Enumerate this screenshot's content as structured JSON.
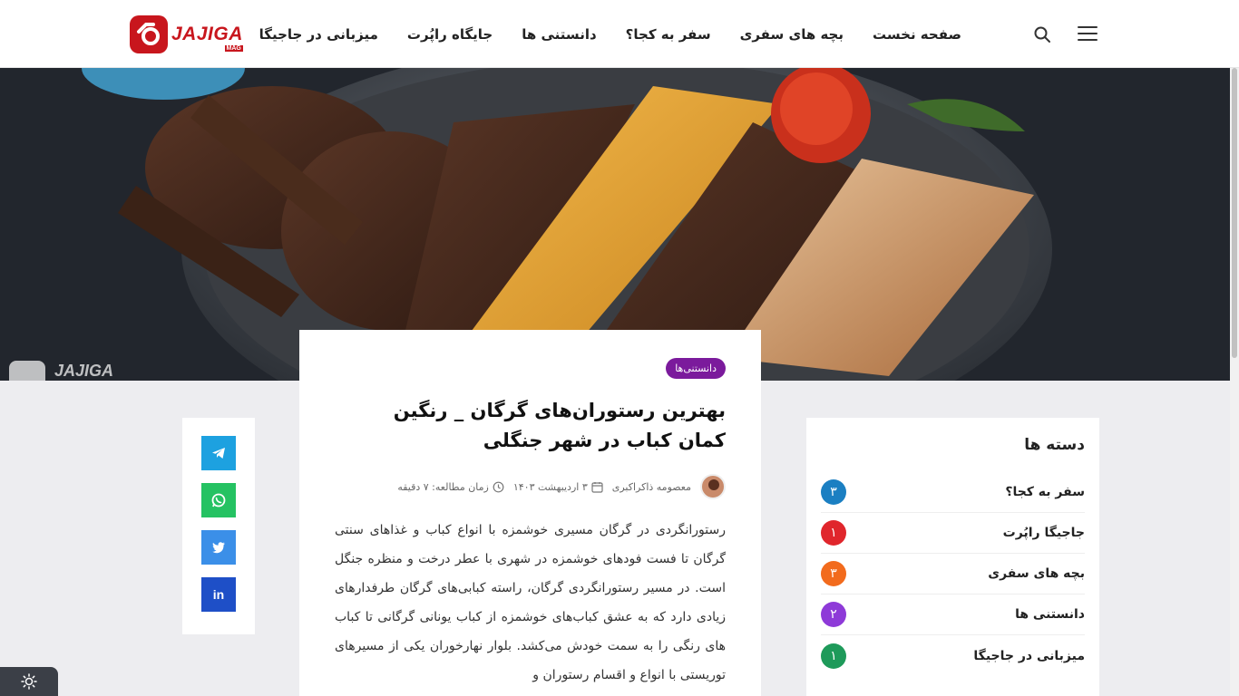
{
  "header": {
    "logo_text": "JAJIGA",
    "logo_sub": "MAG",
    "nav": [
      {
        "label": "صفحه نخست"
      },
      {
        "label": "بچه های سفری"
      },
      {
        "label": "سفر به کجا؟"
      },
      {
        "label": "دانستنی ها"
      },
      {
        "label": "جایگاه راپُرت"
      },
      {
        "label": "میزبانی در جاجیگا"
      }
    ]
  },
  "hero": {
    "watermark": "JAJIGA"
  },
  "article": {
    "category": "دانستنی‌ها",
    "title": "بهترین رستوران‌های گرگان _ رنگین کمان کباب در شهر جنگلی",
    "author": "معصومه ذاکراکبری",
    "date": "۳ اردیبهشت ۱۴۰۳",
    "reading_time": "زمان مطالعه: ۷ دقیقه",
    "body": "رستورانگردی در گرگان مسیری خوشمزه با انواع کباب و غذاهای سنتی گرگان تا فست فودهای خوشمزه در شهری با عطر درخت و منظره جنگل است. در مسیر رستورانگردی گرگان، راسته کبابی‌های گرگان طرفدارهای زیادی دارد که به عشق کباب‌های خوشمزه از کباب یونانی گرگانی تا کباب های رنگی را به سمت خودش می‌کشد. بلوار نهارخوران یکی از مسیرهای توریستی با انواع و اقسام رستوران و"
  },
  "share": {
    "buttons": [
      {
        "name": "telegram",
        "color": "#1da1e0"
      },
      {
        "name": "whatsapp",
        "color": "#25c262"
      },
      {
        "name": "twitter",
        "color": "#3b8fe8"
      },
      {
        "name": "linkedin",
        "color": "#1e4fc7",
        "label": "in"
      }
    ]
  },
  "categories": {
    "title": "دسته ها",
    "items": [
      {
        "name": "سفر به کجا؟",
        "count": "۳",
        "color": "#1b7fc2"
      },
      {
        "name": "جاجیگا راپُرت",
        "count": "۱",
        "color": "#e0262c"
      },
      {
        "name": "بچه های سفری",
        "count": "۳",
        "color": "#f26b1d"
      },
      {
        "name": "دانستنی ها",
        "count": "۲",
        "color": "#8e3ad8"
      },
      {
        "name": "میزبانی در جاجیگا",
        "count": "۱",
        "color": "#1e9a5a"
      }
    ]
  }
}
